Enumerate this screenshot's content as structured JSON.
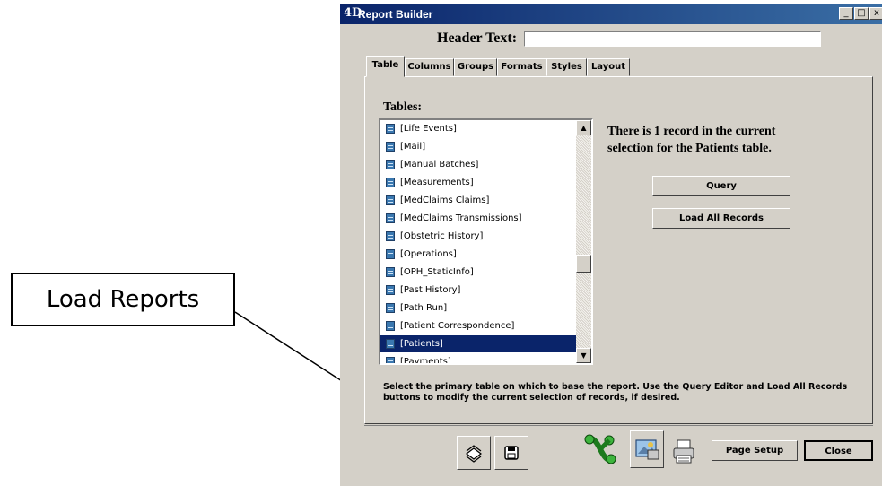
{
  "callout": {
    "text": "Load Reports"
  },
  "window": {
    "title": "Report Builder",
    "logo": "4D",
    "controls": {
      "minimize": "_",
      "maximize": "□",
      "close": "x"
    }
  },
  "header": {
    "label": "Header Text:",
    "value": ""
  },
  "tabs": [
    {
      "label": "Table"
    },
    {
      "label": "Columns"
    },
    {
      "label": "Groups"
    },
    {
      "label": "Formats"
    },
    {
      "label": "Styles"
    },
    {
      "label": "Layout"
    }
  ],
  "tables": {
    "label": "Tables:",
    "items": [
      "[Life Events]",
      "[Mail]",
      "[Manual Batches]",
      "[Measurements]",
      "[MedClaims Claims]",
      "[MedClaims Transmissions]",
      "[Obstetric History]",
      "[Operations]",
      "[OPH_StaticInfo]",
      "[Past History]",
      "[Path Run]",
      "[Patient Correspondence]",
      "[Patients]",
      "[Payments]"
    ],
    "selected": "[Patients]"
  },
  "info": {
    "line1": "There is 1 record in the current",
    "line2": "selection for the Patients table."
  },
  "buttons": {
    "query": "Query",
    "load_all": "Load All Records",
    "page_setup": "Page Setup",
    "close": "Close"
  },
  "description": "Select the primary table on which to base the report. Use the Query Editor and Load All Records buttons to modify the current selection of records, if desired.",
  "icons": {
    "load_reports": "load-reports-icon",
    "save": "floppy-disk-icon",
    "connector": "green-connector-icon",
    "picture": "picture-icon",
    "print": "printer-icon"
  },
  "colors": {
    "title_start": "#0a246a",
    "title_end": "#3a6ea5",
    "selection": "#0a246a",
    "face": "#d4d0c8"
  }
}
